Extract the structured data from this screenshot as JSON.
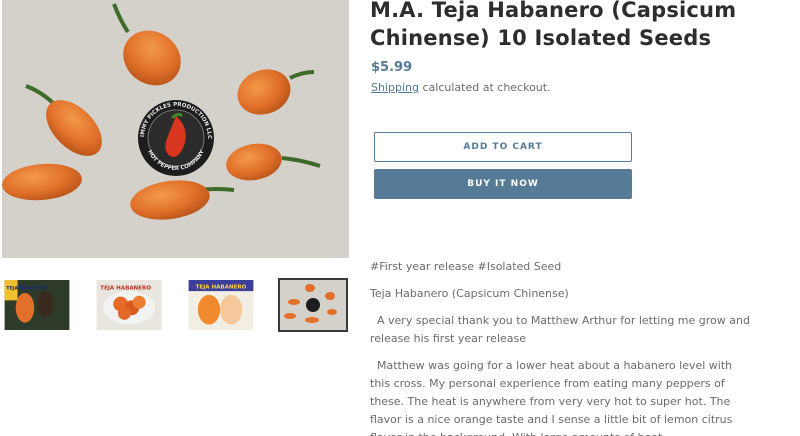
{
  "product": {
    "title": "M.A. Teja Habanero (Capsicum Chinense) 10 Isolated Seeds",
    "price": "$5.99",
    "shipping_link": "Shipping",
    "shipping_suffix": " calculated at checkout.",
    "add_to_cart": "ADD TO CART",
    "buy_now": "BUY IT NOW"
  },
  "logo": {
    "text_top": "JIMMY PICKLES PRODUCTION LLC",
    "text_bottom": "HOT PEPPER COMPANY"
  },
  "thumbnails": {
    "active_index": 3,
    "items": [
      {
        "label": "TEJA HABANERO"
      },
      {
        "label": "TEJA HABANERO"
      },
      {
        "label": "TEJA HABANERO"
      },
      {
        "label": ""
      }
    ]
  },
  "description": {
    "p1": "#First year release #Isolated Seed",
    "p2": "Teja Habanero (Capsicum Chinense)",
    "p3": "  A very special thank you to Matthew Arthur for letting me grow and release his first year release",
    "p4": "  Matthew was going for a lower heat about a habanero level with this cross. My personal experience from eating many peppers of these. The heat is anywhere from very very hot to super hot. The flavor is a nice orange taste and I sense a little bit of lemon citrus flavor in the background. With large amounts of heat."
  }
}
